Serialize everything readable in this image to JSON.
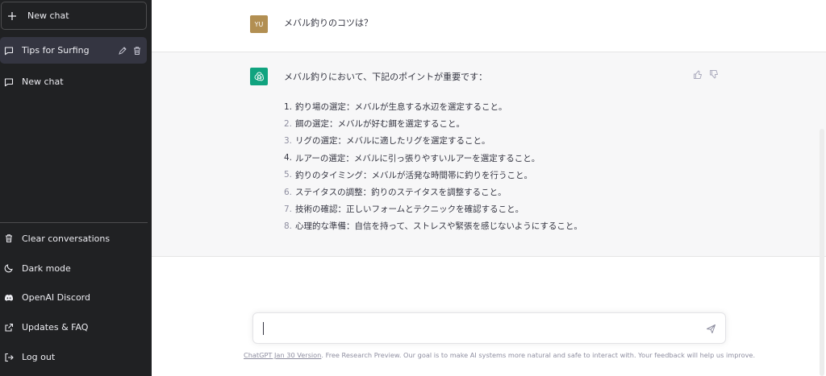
{
  "sidebar": {
    "new_chat_label": "New chat",
    "conversations": [
      {
        "label": "Tips for Surfing",
        "active": true
      },
      {
        "label": "New chat",
        "active": false
      }
    ],
    "menu": [
      {
        "label": "Clear conversations",
        "icon": "trash-icon"
      },
      {
        "label": "Dark mode",
        "icon": "moon-icon"
      },
      {
        "label": "OpenAI Discord",
        "icon": "discord-icon"
      },
      {
        "label": "Updates & FAQ",
        "icon": "external-link-icon"
      },
      {
        "label": "Log out",
        "icon": "logout-icon"
      }
    ]
  },
  "chat": {
    "user_avatar_initials": "YU",
    "user_message": "メバル釣りのコツは？",
    "assistant_intro": "メバル釣りにおいて、下記のポイントが重要です：",
    "assistant_points": [
      {
        "num": "1.",
        "text": "釣り場の選定：メバルが生息する水辺を選定すること。"
      },
      {
        "num": "2.",
        "text": "餌の選定：メバルが好む餌を選定すること。"
      },
      {
        "num": "3.",
        "text": "リグの選定：メバルに適したリグを選定すること。"
      },
      {
        "num": "4.",
        "text": "ルアーの選定：メバルに引っ張りやすいルアーを選定すること。"
      },
      {
        "num": "5.",
        "text": "釣りのタイミング：メバルが活発な時間帯に釣りを行うこと。"
      },
      {
        "num": "6.",
        "text": "ステイタスの調整：釣りのステイタスを調整すること。"
      },
      {
        "num": "7.",
        "text": "技術の確認：正しいフォームとテクニックを確認すること。"
      },
      {
        "num": "8.",
        "text": "心理的な準備：自信を持って、ストレスや緊張を感じないようにすること。"
      }
    ]
  },
  "input": {
    "value": "",
    "placeholder": ""
  },
  "footer": {
    "version_link": "ChatGPT Jan 30 Version",
    "text": ". Free Research Preview. Our goal is to make AI systems more natural and safe to interact with. Your feedback will help us improve."
  },
  "colors": {
    "sidebar_bg": "#202123",
    "active_item_bg": "#343541",
    "assistant_bg": "#f7f7f8",
    "gpt_green": "#10a37f",
    "user_avatar": "#b28f52"
  }
}
